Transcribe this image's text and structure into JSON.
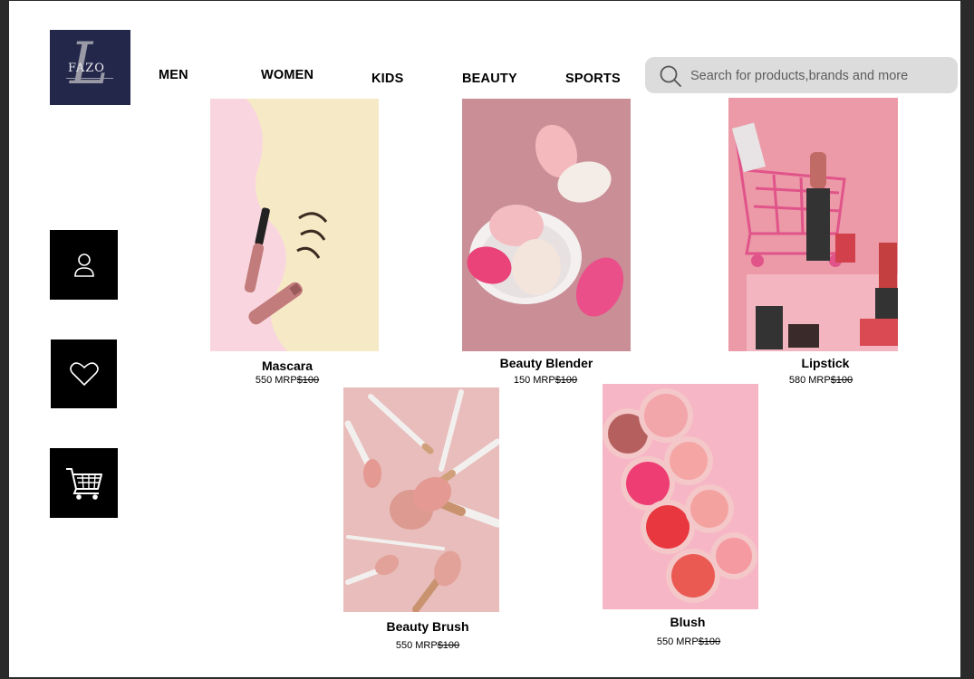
{
  "brand": {
    "logo_text": "FAZO",
    "logo_letter": "L"
  },
  "nav": [
    "MEN",
    "WOMEN",
    "KIDS",
    "BEAUTY",
    "SPORTS"
  ],
  "search": {
    "placeholder": "Search for products,brands and more"
  },
  "sidebar": [
    "user-icon",
    "heart-icon",
    "cart-icon"
  ],
  "products": [
    {
      "name": "Mascara",
      "price": "550 MRP",
      "mrp": "$100"
    },
    {
      "name": "Beauty Blender",
      "price": "150 MRP",
      "mrp": "$100"
    },
    {
      "name": "Lipstick",
      "price": "580 MRP",
      "mrp": "$100"
    },
    {
      "name": "Beauty Brush",
      "price": "550 MRP",
      "mrp": "$100"
    },
    {
      "name": "Blush",
      "price": "550 MRP",
      "mrp": "$100"
    }
  ],
  "colors": {
    "logo_bg": "#23284a",
    "search_bg": "#dcdcdc",
    "sidebar_bg": "#000000"
  }
}
